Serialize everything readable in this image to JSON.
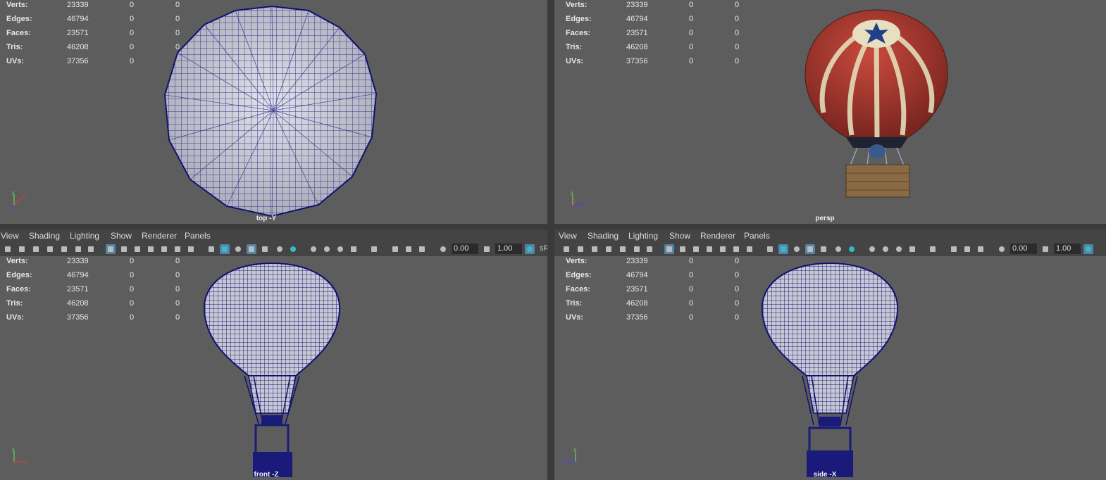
{
  "hud": {
    "labels": [
      "Verts:",
      "Edges:",
      "Faces:",
      "Tris:",
      "UVs:"
    ],
    "values": [
      "23339",
      "46794",
      "23571",
      "46208",
      "37356"
    ],
    "col2": [
      "0",
      "0",
      "0",
      "0",
      "0"
    ],
    "col3": [
      "0",
      "0",
      "0",
      "0",
      "0"
    ]
  },
  "viewports": {
    "top_left": {
      "camera": "top -Y"
    },
    "top_right": {
      "camera": "persp"
    },
    "bottom_left": {
      "camera": "front -Z"
    },
    "bottom_right": {
      "camera": "side -X"
    }
  },
  "menu": [
    "View",
    "Shading",
    "Lighting",
    "Show",
    "Renderer",
    "Panels"
  ],
  "toolbar": {
    "exposure": "0.00",
    "gamma": "1.00",
    "colorspace": "sR"
  },
  "axes": {
    "y": "y",
    "x": "x",
    "z": "z"
  },
  "colors": {
    "wire": "#1a1a7a",
    "balloon_red": "#b13a32",
    "stripe": "#e3dcb8",
    "viewport_bg": "#5d5d5d"
  },
  "icons": [
    "camera-icon",
    "grid-icon",
    "wireframe-icon",
    "smooth-shade-icon",
    "light-icon",
    "isolate-icon"
  ]
}
